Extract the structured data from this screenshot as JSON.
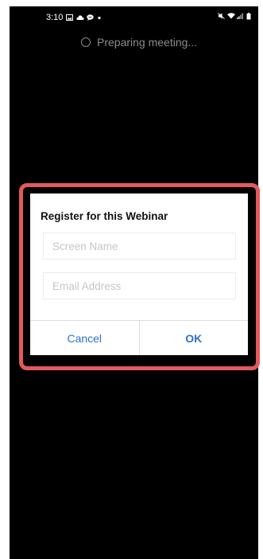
{
  "status_bar": {
    "time": "3:10",
    "left_icons": [
      "gallery-icon",
      "cloud-icon",
      "chat-bubble-icon",
      "dot-icon"
    ],
    "right_icons": [
      "mute-icon",
      "wifi-icon",
      "signal-icon",
      "battery-icon"
    ]
  },
  "loading": {
    "text": "Preparing meeting..."
  },
  "dialog": {
    "title": "Register for this Webinar",
    "screen_name": {
      "value": "",
      "placeholder": "Screen Name"
    },
    "email": {
      "value": "",
      "placeholder": "Email Address"
    },
    "cancel_label": "Cancel",
    "ok_label": "OK"
  },
  "colors": {
    "background": "#000000",
    "dialog": "#ffffff",
    "accent": "#2e73c9",
    "highlight": "#e25a5a",
    "muted_text": "#8a8a8a"
  }
}
